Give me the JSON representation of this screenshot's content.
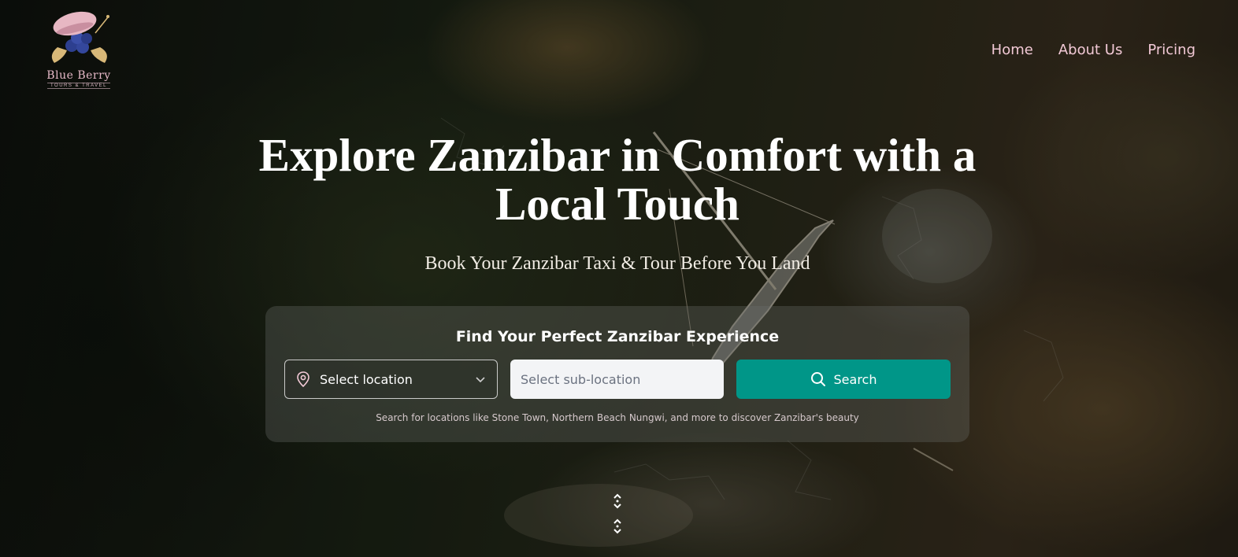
{
  "brand": {
    "name": "Blue Berry",
    "tagline": "TOURS & TRAVEL",
    "logo_icon": "beret-blueberry-icon",
    "accent_color": "#f2c9d6"
  },
  "nav": {
    "items": [
      {
        "label": "Home"
      },
      {
        "label": "About Us"
      },
      {
        "label": "Pricing"
      }
    ]
  },
  "hero": {
    "title_line1": "Explore Zanzibar in Comfort with a",
    "title_line2": "Local Touch",
    "subtitle": "Book Your Zanzibar Taxi & Tour Before You Land"
  },
  "search": {
    "title": "Find Your Perfect Zanzibar Experience",
    "location_select": {
      "selected": "Select location",
      "icon": "map-pin-icon",
      "chevron": "chevron-down-icon"
    },
    "sublocation_input": {
      "value": "",
      "placeholder": "Select sub-location"
    },
    "button": {
      "label": "Search",
      "icon": "search-icon",
      "color": "#009688"
    },
    "hint": "Search for locations like Stone Town, Northern Beach Nungwi, and more to discover Zanzibar's beauty"
  },
  "scroll_indicator": {
    "icon": "scroll-arrows-icon"
  }
}
